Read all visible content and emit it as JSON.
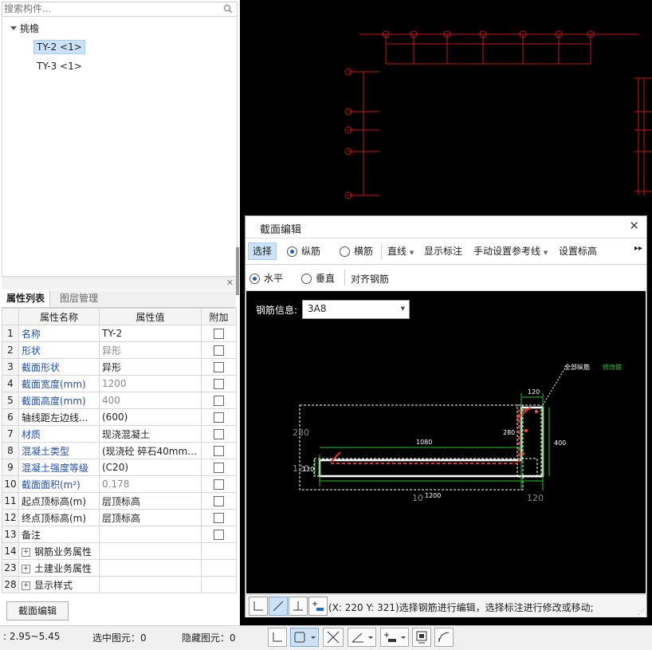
{
  "search": {
    "placeholder": "搜索构件..."
  },
  "tree": {
    "group": "挑檐",
    "items": [
      "TY-2 <1>",
      "TY-3 <1>"
    ]
  },
  "props_tabs": [
    "属性列表",
    "图层管理"
  ],
  "props_header": [
    "属性名称",
    "属性值",
    "附加"
  ],
  "props_rows": [
    {
      "num": "1",
      "name": "名称",
      "value": "TY-2"
    },
    {
      "num": "2",
      "name": "形状",
      "value": "异形"
    },
    {
      "num": "3",
      "name": "截面形状",
      "value": "异形"
    },
    {
      "num": "4",
      "name": "截面宽度(mm)",
      "value": "1200"
    },
    {
      "num": "5",
      "name": "截面高度(mm)",
      "value": "400"
    },
    {
      "num": "6",
      "name": "轴线距左边线...",
      "value": "(600)"
    },
    {
      "num": "7",
      "name": "材质",
      "value": "现浇混凝土"
    },
    {
      "num": "8",
      "name": "混凝土类型",
      "value": "(现浇砼 碎石40mm ..."
    },
    {
      "num": "9",
      "name": "混凝土强度等级",
      "value": "(C20)"
    },
    {
      "num": "10",
      "name": "截面面积(m²)",
      "value": "0.178"
    },
    {
      "num": "11",
      "name": "起点顶标高(m)",
      "value": "层顶标高"
    },
    {
      "num": "12",
      "name": "终点顶标高(m)",
      "value": "层顶标高"
    },
    {
      "num": "13",
      "name": "备注",
      "value": ""
    },
    {
      "num": "14",
      "name": "钢筋业务属性",
      "value": ""
    },
    {
      "num": "23",
      "name": "土建业务属性",
      "value": ""
    },
    {
      "num": "28",
      "name": "显示样式",
      "value": ""
    }
  ],
  "section_edit_button": "截面编辑",
  "status_bar": {
    "range": ": 2.95~5.45",
    "selected": "选中图元：0",
    "hidden": "隐藏图元：0"
  },
  "dialog": {
    "title": "截面编辑",
    "toolbar1": {
      "select": "选择",
      "longitudinal": "纵筋",
      "transverse": "横筋",
      "line": "直线",
      "show_labels": "显示标注",
      "manual_ref": "手动设置参考线",
      "set_elevation": "设置标高"
    },
    "toolbar2": {
      "horizontal": "水平",
      "vertical": "垂直",
      "align": "对齐钢筋"
    },
    "rebar_info_label": "钢筋信息:",
    "rebar_info_value": "3A8",
    "drawing_labels": {
      "all_long": "全部纵筋",
      "modify": "修改箍",
      "d120_top": "120",
      "d280_mid": "280",
      "d1080": "1080",
      "d400": "400",
      "d280_left": "280",
      "d120_left": "120",
      "d120_small": "120",
      "d1200": "1200",
      "d10": "10",
      "d120_bottom": "120"
    },
    "status_text": "(X: 220 Y: 321)选择钢筋进行编辑，选择标注进行修改或移动;"
  },
  "colors": {
    "canvas_bg": "#000000",
    "axis_red": "#c81414",
    "dim_green": "#1ec81e",
    "accent_blue": "#1f4fb4"
  }
}
